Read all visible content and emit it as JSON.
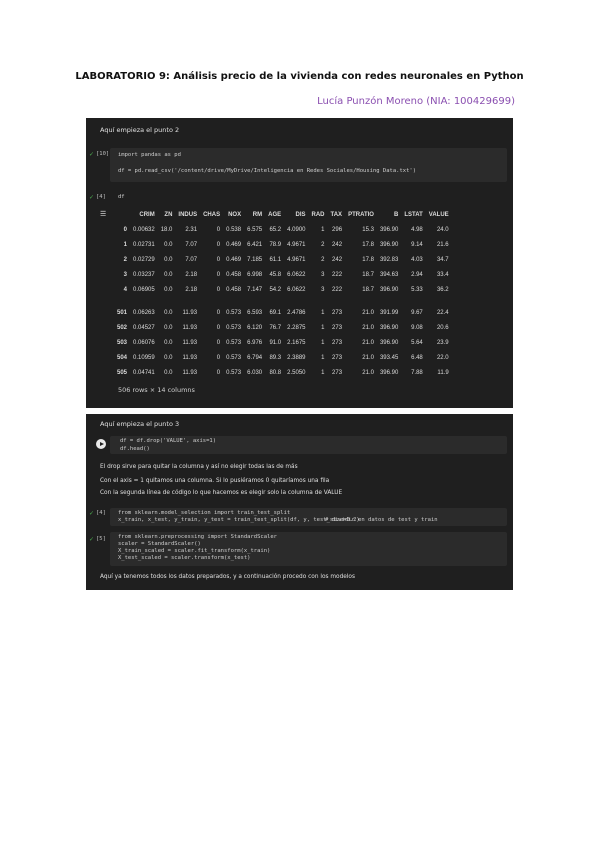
{
  "title": "LABORATORIO 9: Análisis precio de la vivienda con redes neuronales en Python",
  "author": "Lucía Punzón Moreno (NIA: 100429699)",
  "panel1": {
    "header": "Aquí empieza el punto 2",
    "cell1_prompt": "[10]",
    "cell1_line1": "import pandas as pd",
    "cell1_line2": "df = pd.read_csv('/content/drive/MyDrive/Inteligencia en Redes Sociales/Housing Data.txt')",
    "cell2_prompt": "[4]",
    "cell2_code": "df",
    "table": {
      "columns": [
        "",
        "CRIM",
        "ZN",
        "INDUS",
        "CHAS",
        "NOX",
        "RM",
        "AGE",
        "DIS",
        "RAD",
        "TAX",
        "PTRATIO",
        "B",
        "LSTAT",
        "VALUE"
      ],
      "rows": [
        [
          "0",
          "0.00632",
          "18.0",
          "2.31",
          "0",
          "0.538",
          "6.575",
          "65.2",
          "4.0900",
          "1",
          "296",
          "15.3",
          "396.90",
          "4.98",
          "24.0"
        ],
        [
          "1",
          "0.02731",
          "0.0",
          "7.07",
          "0",
          "0.469",
          "6.421",
          "78.9",
          "4.9671",
          "2",
          "242",
          "17.8",
          "396.90",
          "9.14",
          "21.6"
        ],
        [
          "2",
          "0.02729",
          "0.0",
          "7.07",
          "0",
          "0.469",
          "7.185",
          "61.1",
          "4.9671",
          "2",
          "242",
          "17.8",
          "392.83",
          "4.03",
          "34.7"
        ],
        [
          "3",
          "0.03237",
          "0.0",
          "2.18",
          "0",
          "0.458",
          "6.998",
          "45.8",
          "6.0622",
          "3",
          "222",
          "18.7",
          "394.63",
          "2.94",
          "33.4"
        ],
        [
          "4",
          "0.06905",
          "0.0",
          "2.18",
          "0",
          "0.458",
          "7.147",
          "54.2",
          "6.0622",
          "3",
          "222",
          "18.7",
          "396.90",
          "5.33",
          "36.2"
        ],
        [
          "501",
          "0.06263",
          "0.0",
          "11.93",
          "0",
          "0.573",
          "6.593",
          "69.1",
          "2.4786",
          "1",
          "273",
          "21.0",
          "391.99",
          "9.67",
          "22.4"
        ],
        [
          "502",
          "0.04527",
          "0.0",
          "11.93",
          "0",
          "0.573",
          "6.120",
          "76.7",
          "2.2875",
          "1",
          "273",
          "21.0",
          "396.90",
          "9.08",
          "20.6"
        ],
        [
          "503",
          "0.06076",
          "0.0",
          "11.93",
          "0",
          "0.573",
          "6.976",
          "91.0",
          "2.1675",
          "1",
          "273",
          "21.0",
          "396.90",
          "5.64",
          "23.9"
        ],
        [
          "504",
          "0.10959",
          "0.0",
          "11.93",
          "0",
          "0.573",
          "6.794",
          "89.3",
          "2.3889",
          "1",
          "273",
          "21.0",
          "393.45",
          "6.48",
          "22.0"
        ],
        [
          "505",
          "0.04741",
          "0.0",
          "11.93",
          "0",
          "0.573",
          "6.030",
          "80.8",
          "2.5050",
          "1",
          "273",
          "21.0",
          "396.90",
          "7.88",
          "11.9"
        ]
      ],
      "ellipsis": "...",
      "summary": "506 rows × 14 columns"
    }
  },
  "panel2": {
    "header": "Aquí empieza el punto 3",
    "run_code_line1": "df = df.drop('VALUE', axis=1)",
    "run_code_line2": "df.head()",
    "text1": "El drop sirve para quitar la columna y así no elegir todas las de más",
    "text2": "Con el axis = 1 quitamos una columna. Si lo pusiéramos 0 quitaríamos una fila",
    "text3": "Con la segunda línea de código lo que hacemos es elegir solo la columna de VALUE",
    "cell3_prompt": "[4]",
    "cell3_line1": "from sklearn.model_selection import train_test_split",
    "cell3_line2": "x_train, x_test, y_train, y_test = train_test_split(df, y, test_size=0.2)",
    "cell3_comment": "# dividir en datos de test y train",
    "cell4_prompt": "[5]",
    "cell4_line1": "from sklearn.preprocessing import StandardScaler",
    "cell4_line2": "scaler = StandardScaler()",
    "cell4_line3": "X_train_scaled = scaler.fit_transform(x_train)",
    "cell4_line4": "X_test_scaled = scaler.transform(x_test)",
    "text4": "Aquí ya tenemos todos los datos preparados, y a continuación procedo con los modelos"
  },
  "colors": {
    "panel_bg": "#1f1f1f",
    "cell_bg": "#2b2b2b",
    "author": "#8a4fb0",
    "check": "#4caf50"
  }
}
